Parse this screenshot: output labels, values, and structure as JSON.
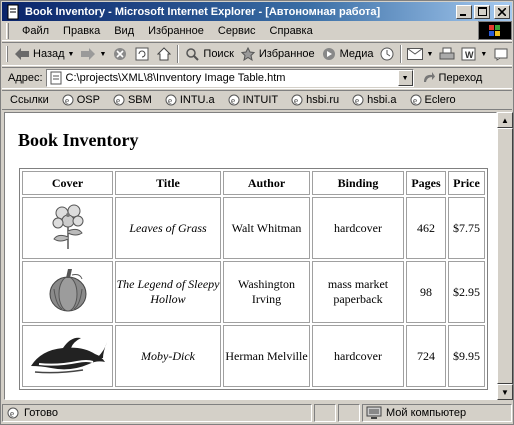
{
  "window": {
    "title": "Book Inventory - Microsoft Internet Explorer - [Автономная работа]"
  },
  "menu": [
    "Файл",
    "Правка",
    "Вид",
    "Избранное",
    "Сервис",
    "Справка"
  ],
  "toolbar": {
    "back": "Назад",
    "search": "Поиск",
    "favorites": "Избранное",
    "media": "Медиа"
  },
  "address": {
    "label": "Адрес:",
    "url": "C:\\projects\\XML\\8\\Inventory Image Table.htm",
    "go": "Переход"
  },
  "links": {
    "label": "Ссылки",
    "items": [
      "OSP",
      "SBM",
      "INTU.a",
      "INTUIT",
      "hsbi.ru",
      "hsbi.a",
      "Eclero"
    ]
  },
  "page": {
    "title": "Book Inventory"
  },
  "table": {
    "headers": {
      "cover": "Cover",
      "title": "Title",
      "author": "Author",
      "binding": "Binding",
      "pages": "Pages",
      "price": "Price"
    },
    "rows": [
      {
        "cover": "flower-image",
        "title": "Leaves of Grass",
        "author": "Walt Whitman",
        "binding": "hardcover",
        "pages": "462",
        "price": "$7.75"
      },
      {
        "cover": "pumpkin-image",
        "title": "The Legend of Sleepy Hollow",
        "author": "Washington Irving",
        "binding": "mass market paperback",
        "pages": "98",
        "price": "$2.95"
      },
      {
        "cover": "whale-image",
        "title": "Moby-Dick",
        "author": "Herman Melville",
        "binding": "hardcover",
        "pages": "724",
        "price": "$9.95"
      }
    ]
  },
  "status": {
    "text": "Готово",
    "zone": "Мой компьютер"
  }
}
